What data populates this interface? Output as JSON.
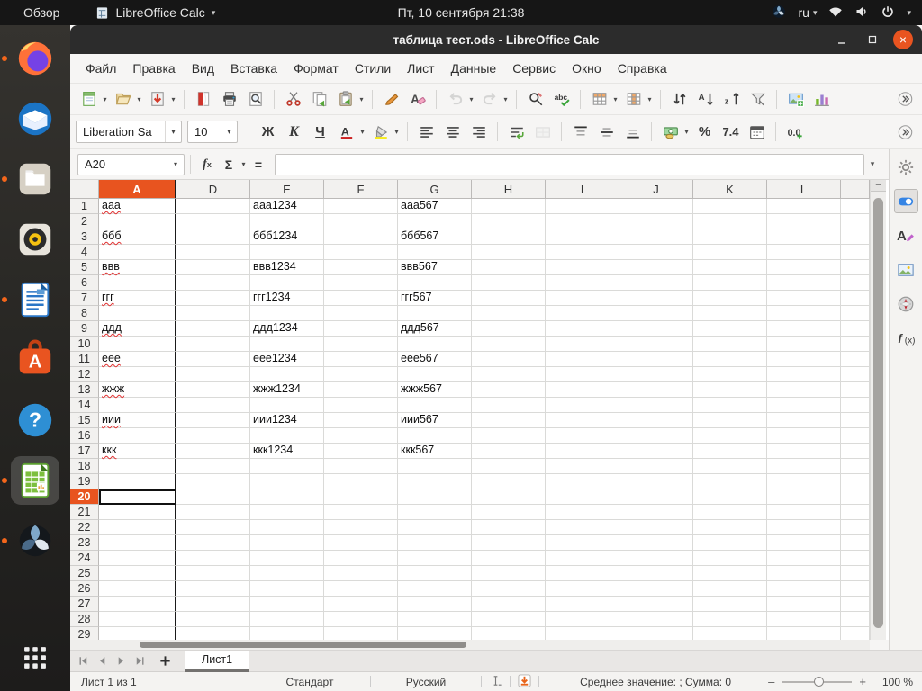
{
  "topbar": {
    "activities_label": "Обзор",
    "app_menu_label": "LibreOffice Calc",
    "clock": "Пт, 10 сентября 21:38",
    "keyboard_layout": "ru"
  },
  "dock": {
    "items": [
      {
        "icon": "firefox",
        "running": true,
        "active": false
      },
      {
        "icon": "thunderbird",
        "running": false,
        "active": false
      },
      {
        "icon": "file-manager",
        "running": true,
        "active": false
      },
      {
        "icon": "rhythmbox",
        "running": false,
        "active": false
      },
      {
        "icon": "libreoffice-writer",
        "running": true,
        "active": false
      },
      {
        "icon": "ubuntu-software",
        "running": false,
        "active": false
      },
      {
        "icon": "help",
        "running": false,
        "active": false
      },
      {
        "icon": "libreoffice-calc",
        "running": true,
        "active": true
      },
      {
        "icon": "pinwheel-app",
        "running": true,
        "active": false
      }
    ],
    "show_apps_icon": "show-applications"
  },
  "window": {
    "title": "таблица тест.ods - LibreOffice Calc"
  },
  "menubar": {
    "items": [
      {
        "id": "file",
        "label": "Файл"
      },
      {
        "id": "edit",
        "label": "Правка"
      },
      {
        "id": "view",
        "label": "Вид"
      },
      {
        "id": "insert",
        "label": "Вставка"
      },
      {
        "id": "format",
        "label": "Формат"
      },
      {
        "id": "styles",
        "label": "Стили"
      },
      {
        "id": "sheet",
        "label": "Лист"
      },
      {
        "id": "data",
        "label": "Данные"
      },
      {
        "id": "tools",
        "label": "Сервис"
      },
      {
        "id": "window",
        "label": "Окно"
      },
      {
        "id": "help",
        "label": "Справка"
      }
    ]
  },
  "toolbar_standard": {
    "items": [
      {
        "type": "icon",
        "name": "new-document",
        "dropdown": true
      },
      {
        "type": "icon",
        "name": "open",
        "dropdown": true
      },
      {
        "type": "icon",
        "name": "save",
        "dropdown": true
      },
      {
        "type": "sep"
      },
      {
        "type": "icon",
        "name": "export-pdf"
      },
      {
        "type": "icon",
        "name": "print"
      },
      {
        "type": "icon",
        "name": "print-preview"
      },
      {
        "type": "sep"
      },
      {
        "type": "icon",
        "name": "cut"
      },
      {
        "type": "icon",
        "name": "copy"
      },
      {
        "type": "icon",
        "name": "paste",
        "dropdown": true
      },
      {
        "type": "sep"
      },
      {
        "type": "icon",
        "name": "clone-formatting"
      },
      {
        "type": "icon",
        "name": "clear-formatting"
      },
      {
        "type": "sep"
      },
      {
        "type": "icon",
        "name": "undo",
        "dropdown": true,
        "disabled": true
      },
      {
        "type": "icon",
        "name": "redo",
        "dropdown": true,
        "disabled": true
      },
      {
        "type": "sep"
      },
      {
        "type": "icon",
        "name": "find-replace"
      },
      {
        "type": "icon",
        "name": "spelling"
      },
      {
        "type": "sep"
      },
      {
        "type": "icon",
        "name": "insert-row",
        "dropdown": true
      },
      {
        "type": "icon",
        "name": "insert-column",
        "dropdown": true
      },
      {
        "type": "sep"
      },
      {
        "type": "icon",
        "name": "sort"
      },
      {
        "type": "icon",
        "name": "sort-ascending"
      },
      {
        "type": "icon",
        "name": "sort-descending"
      },
      {
        "type": "icon",
        "name": "autofilter"
      },
      {
        "type": "sep"
      },
      {
        "type": "icon",
        "name": "insert-image"
      },
      {
        "type": "icon",
        "name": "insert-chart"
      }
    ]
  },
  "toolbar_formatting": {
    "items": [
      {
        "type": "combo",
        "name": "font-name",
        "value": "Liberation Sa",
        "width": 118
      },
      {
        "type": "combo",
        "name": "font-size",
        "value": "10",
        "width": 56
      },
      {
        "type": "sep"
      },
      {
        "type": "glyph",
        "name": "bold",
        "glyph": "Ж"
      },
      {
        "type": "glyph",
        "name": "italic",
        "glyph": "K"
      },
      {
        "type": "glyph",
        "name": "underline",
        "glyph": "Ч"
      },
      {
        "type": "icon",
        "name": "font-color",
        "dropdown": true
      },
      {
        "type": "icon",
        "name": "highlight-color",
        "dropdown": true
      },
      {
        "type": "sep"
      },
      {
        "type": "icon",
        "name": "align-left"
      },
      {
        "type": "icon",
        "name": "align-center"
      },
      {
        "type": "icon",
        "name": "align-right"
      },
      {
        "type": "sep"
      },
      {
        "type": "icon",
        "name": "wrap-text"
      },
      {
        "type": "icon",
        "name": "merge-cells",
        "disabled": true
      },
      {
        "type": "sep"
      },
      {
        "type": "icon",
        "name": "align-top"
      },
      {
        "type": "icon",
        "name": "center-vertically"
      },
      {
        "type": "icon",
        "name": "align-bottom"
      },
      {
        "type": "sep"
      },
      {
        "type": "icon",
        "name": "currency",
        "dropdown": true
      },
      {
        "type": "glyph",
        "name": "percent",
        "glyph": "%"
      },
      {
        "type": "glyph",
        "name": "number-format",
        "glyph": "7.4"
      },
      {
        "type": "icon",
        "name": "date"
      },
      {
        "type": "sep"
      },
      {
        "type": "icon",
        "name": "add-decimal"
      }
    ]
  },
  "formula_bar": {
    "cell_reference": "A20",
    "formula_value": "",
    "buttons": [
      {
        "name": "function-wizard",
        "glyph": "fx"
      },
      {
        "name": "sum",
        "glyph": "Σ",
        "dropdown": true
      },
      {
        "name": "equals",
        "glyph": "="
      }
    ]
  },
  "spreadsheet": {
    "column_headers": [
      "A",
      "D",
      "E",
      "F",
      "G",
      "H",
      "I",
      "J",
      "K",
      "L",
      ""
    ],
    "selected_column": "A",
    "hidden_boundary_after_column": "A",
    "visible_row_count": 29,
    "selected_row": 20,
    "active_cell": "A20",
    "spellcheck_columns": [
      "A"
    ],
    "rows": [
      {
        "n": 1,
        "A": "ааа",
        "E": "ааа1234",
        "G": "ааа567"
      },
      {
        "n": 3,
        "A": "ббб",
        "E": "ббб1234",
        "G": "ббб567"
      },
      {
        "n": 5,
        "A": "ввв",
        "E": "ввв1234",
        "G": "ввв567"
      },
      {
        "n": 7,
        "A": "ггг",
        "E": "ггг1234",
        "G": "ггг567"
      },
      {
        "n": 9,
        "A": "ддд",
        "E": "ддд1234",
        "G": "ддд567"
      },
      {
        "n": 11,
        "A": "еее",
        "E": "еее1234",
        "G": "еее567"
      },
      {
        "n": 13,
        "A": "жжж",
        "E": "жжж1234",
        "G": "жжж567"
      },
      {
        "n": 15,
        "A": "иии",
        "E": "иии1234",
        "G": "иии567"
      },
      {
        "n": 17,
        "A": "ккк",
        "E": "ккк1234",
        "G": "ккк567"
      }
    ]
  },
  "sidebar": {
    "tabs": [
      {
        "icon": "sidebar-settings",
        "active": false
      },
      {
        "icon": "properties",
        "active": true
      },
      {
        "icon": "styles",
        "active": false
      },
      {
        "icon": "gallery",
        "active": false
      },
      {
        "icon": "navigator",
        "active": false
      },
      {
        "icon": "functions",
        "active": false
      }
    ]
  },
  "sheet_tabs": {
    "nav_icons": [
      "first-sheet",
      "previous-sheet",
      "next-sheet",
      "last-sheet"
    ],
    "tabs": [
      {
        "label": "Лист1",
        "active": true
      }
    ]
  },
  "status_bar": {
    "sheet_position": "Лист 1 из 1",
    "page_style": "Стандарт",
    "language": "Русский",
    "selection_summary": "Среднее значение: ; Сумма: 0",
    "zoom_percent": "100 %"
  },
  "colors": {
    "accent": "#e95420",
    "selected_header": "#e8541f",
    "spell_underline": "#e03030",
    "running_dot": "#f4661b"
  }
}
